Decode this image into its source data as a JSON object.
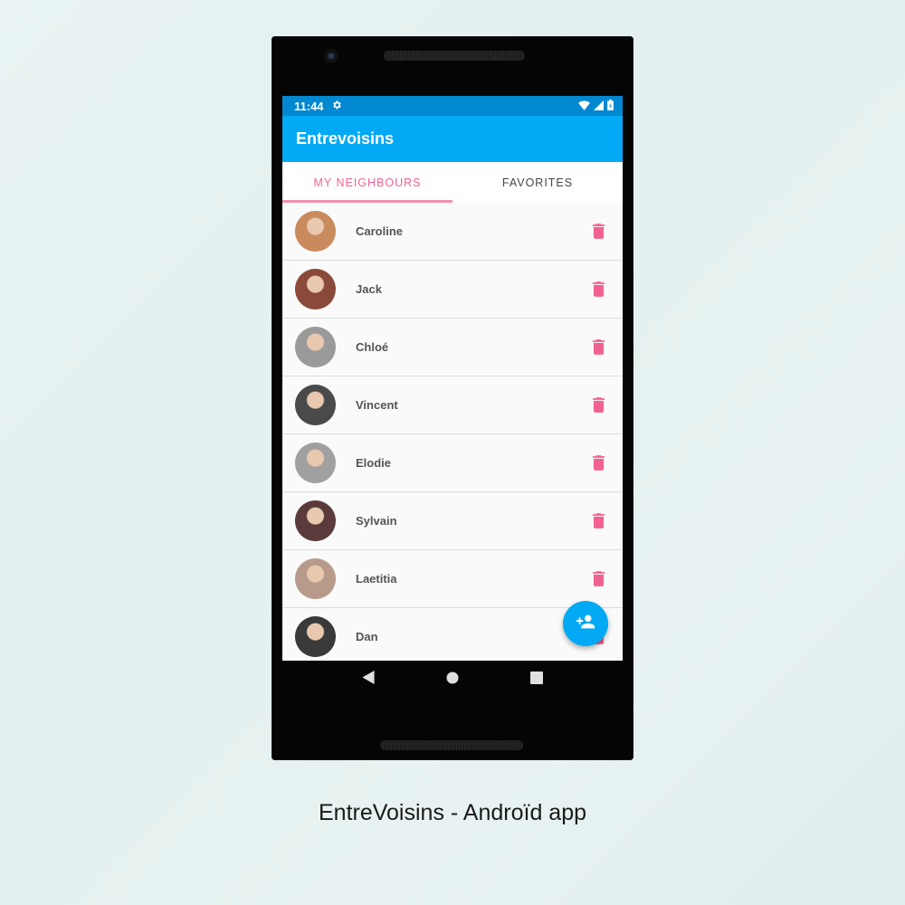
{
  "status_bar": {
    "time": "11:44",
    "settings_icon": "gear-icon",
    "wifi_icon": "wifi-icon",
    "signal_icon": "signal-icon",
    "battery_icon": "battery-icon"
  },
  "app_bar": {
    "title": "Entrevoisins"
  },
  "tabs": [
    {
      "label": "MY NEIGHBOURS",
      "active": true
    },
    {
      "label": "FAVORITES",
      "active": false
    }
  ],
  "neighbours": [
    {
      "name": "Caroline",
      "avatar_color": "#c98a5e"
    },
    {
      "name": "Jack",
      "avatar_color": "#8a4a3a"
    },
    {
      "name": "Chloé",
      "avatar_color": "#9a9a9a"
    },
    {
      "name": "Vincent",
      "avatar_color": "#4a4a4a"
    },
    {
      "name": "Elodie",
      "avatar_color": "#a0a0a0"
    },
    {
      "name": "Sylvain",
      "avatar_color": "#5a3a3a"
    },
    {
      "name": "Laetitia",
      "avatar_color": "#b89a8a"
    },
    {
      "name": "Dan",
      "avatar_color": "#3a3a3a"
    }
  ],
  "fab": {
    "icon": "add-person-icon"
  },
  "nav_bar": {
    "back_icon": "back-icon",
    "home_icon": "home-icon",
    "recents_icon": "recents-icon"
  },
  "caption": "EntreVoisins - Androïd app",
  "colors": {
    "primary": "#03a9f4",
    "primary_dark": "#0288d1",
    "accent": "#f48fb1",
    "delete": "#f06292"
  }
}
